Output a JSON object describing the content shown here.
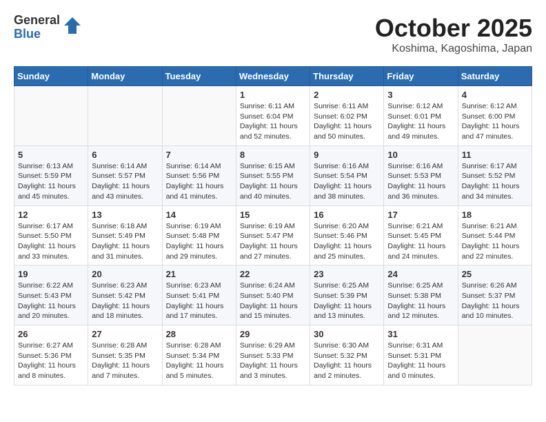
{
  "logo": {
    "general": "General",
    "blue": "Blue"
  },
  "header": {
    "month": "October 2025",
    "location": "Koshima, Kagoshima, Japan"
  },
  "weekdays": [
    "Sunday",
    "Monday",
    "Tuesday",
    "Wednesday",
    "Thursday",
    "Friday",
    "Saturday"
  ],
  "weeks": [
    [
      {
        "day": "",
        "detail": ""
      },
      {
        "day": "",
        "detail": ""
      },
      {
        "day": "",
        "detail": ""
      },
      {
        "day": "1",
        "detail": "Sunrise: 6:11 AM\nSunset: 6:04 PM\nDaylight: 11 hours\nand 52 minutes."
      },
      {
        "day": "2",
        "detail": "Sunrise: 6:11 AM\nSunset: 6:02 PM\nDaylight: 11 hours\nand 50 minutes."
      },
      {
        "day": "3",
        "detail": "Sunrise: 6:12 AM\nSunset: 6:01 PM\nDaylight: 11 hours\nand 49 minutes."
      },
      {
        "day": "4",
        "detail": "Sunrise: 6:12 AM\nSunset: 6:00 PM\nDaylight: 11 hours\nand 47 minutes."
      }
    ],
    [
      {
        "day": "5",
        "detail": "Sunrise: 6:13 AM\nSunset: 5:59 PM\nDaylight: 11 hours\nand 45 minutes."
      },
      {
        "day": "6",
        "detail": "Sunrise: 6:14 AM\nSunset: 5:57 PM\nDaylight: 11 hours\nand 43 minutes."
      },
      {
        "day": "7",
        "detail": "Sunrise: 6:14 AM\nSunset: 5:56 PM\nDaylight: 11 hours\nand 41 minutes."
      },
      {
        "day": "8",
        "detail": "Sunrise: 6:15 AM\nSunset: 5:55 PM\nDaylight: 11 hours\nand 40 minutes."
      },
      {
        "day": "9",
        "detail": "Sunrise: 6:16 AM\nSunset: 5:54 PM\nDaylight: 11 hours\nand 38 minutes."
      },
      {
        "day": "10",
        "detail": "Sunrise: 6:16 AM\nSunset: 5:53 PM\nDaylight: 11 hours\nand 36 minutes."
      },
      {
        "day": "11",
        "detail": "Sunrise: 6:17 AM\nSunset: 5:52 PM\nDaylight: 11 hours\nand 34 minutes."
      }
    ],
    [
      {
        "day": "12",
        "detail": "Sunrise: 6:17 AM\nSunset: 5:50 PM\nDaylight: 11 hours\nand 33 minutes."
      },
      {
        "day": "13",
        "detail": "Sunrise: 6:18 AM\nSunset: 5:49 PM\nDaylight: 11 hours\nand 31 minutes."
      },
      {
        "day": "14",
        "detail": "Sunrise: 6:19 AM\nSunset: 5:48 PM\nDaylight: 11 hours\nand 29 minutes."
      },
      {
        "day": "15",
        "detail": "Sunrise: 6:19 AM\nSunset: 5:47 PM\nDaylight: 11 hours\nand 27 minutes."
      },
      {
        "day": "16",
        "detail": "Sunrise: 6:20 AM\nSunset: 5:46 PM\nDaylight: 11 hours\nand 25 minutes."
      },
      {
        "day": "17",
        "detail": "Sunrise: 6:21 AM\nSunset: 5:45 PM\nDaylight: 11 hours\nand 24 minutes."
      },
      {
        "day": "18",
        "detail": "Sunrise: 6:21 AM\nSunset: 5:44 PM\nDaylight: 11 hours\nand 22 minutes."
      }
    ],
    [
      {
        "day": "19",
        "detail": "Sunrise: 6:22 AM\nSunset: 5:43 PM\nDaylight: 11 hours\nand 20 minutes."
      },
      {
        "day": "20",
        "detail": "Sunrise: 6:23 AM\nSunset: 5:42 PM\nDaylight: 11 hours\nand 18 minutes."
      },
      {
        "day": "21",
        "detail": "Sunrise: 6:23 AM\nSunset: 5:41 PM\nDaylight: 11 hours\nand 17 minutes."
      },
      {
        "day": "22",
        "detail": "Sunrise: 6:24 AM\nSunset: 5:40 PM\nDaylight: 11 hours\nand 15 minutes."
      },
      {
        "day": "23",
        "detail": "Sunrise: 6:25 AM\nSunset: 5:39 PM\nDaylight: 11 hours\nand 13 minutes."
      },
      {
        "day": "24",
        "detail": "Sunrise: 6:25 AM\nSunset: 5:38 PM\nDaylight: 11 hours\nand 12 minutes."
      },
      {
        "day": "25",
        "detail": "Sunrise: 6:26 AM\nSunset: 5:37 PM\nDaylight: 11 hours\nand 10 minutes."
      }
    ],
    [
      {
        "day": "26",
        "detail": "Sunrise: 6:27 AM\nSunset: 5:36 PM\nDaylight: 11 hours\nand 8 minutes."
      },
      {
        "day": "27",
        "detail": "Sunrise: 6:28 AM\nSunset: 5:35 PM\nDaylight: 11 hours\nand 7 minutes."
      },
      {
        "day": "28",
        "detail": "Sunrise: 6:28 AM\nSunset: 5:34 PM\nDaylight: 11 hours\nand 5 minutes."
      },
      {
        "day": "29",
        "detail": "Sunrise: 6:29 AM\nSunset: 5:33 PM\nDaylight: 11 hours\nand 3 minutes."
      },
      {
        "day": "30",
        "detail": "Sunrise: 6:30 AM\nSunset: 5:32 PM\nDaylight: 11 hours\nand 2 minutes."
      },
      {
        "day": "31",
        "detail": "Sunrise: 6:31 AM\nSunset: 5:31 PM\nDaylight: 11 hours\nand 0 minutes."
      },
      {
        "day": "",
        "detail": ""
      }
    ]
  ]
}
